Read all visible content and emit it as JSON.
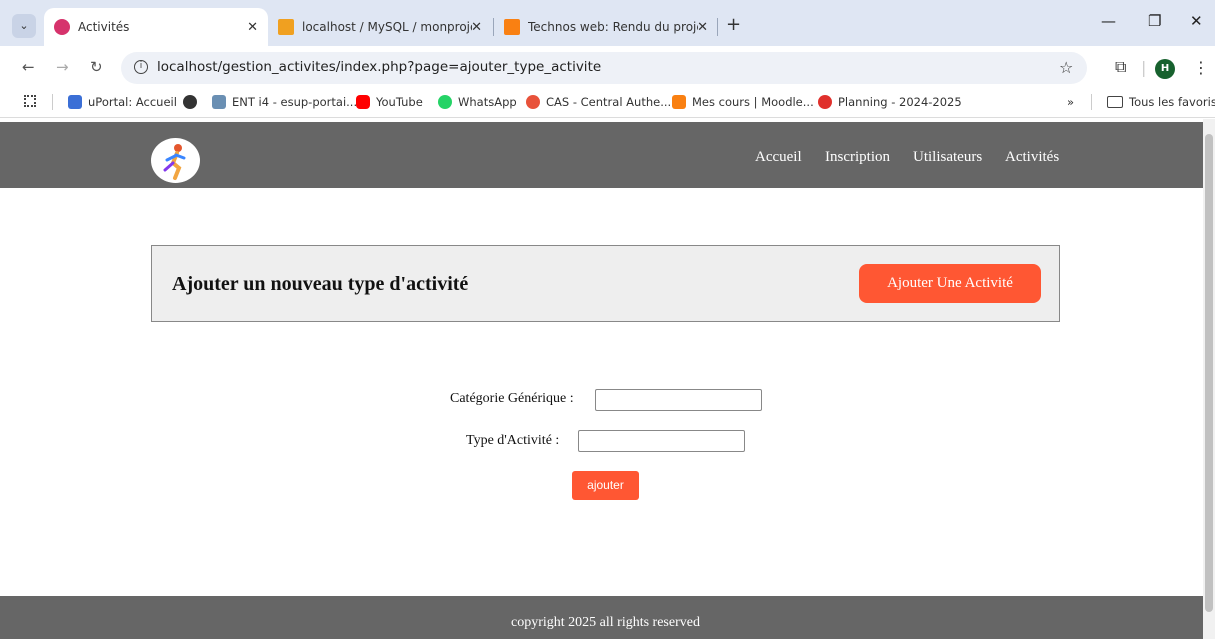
{
  "browser": {
    "tabs": [
      {
        "title": "Activités",
        "favicon_color": "#d6336c"
      },
      {
        "title": "localhost / MySQL / monprojet",
        "favicon_color": "#f0a020"
      },
      {
        "title": "Technos web: Rendu du projet",
        "favicon_color": "#f98012"
      }
    ],
    "url": "localhost/gestion_activites/index.php?page=ajouter_type_activite",
    "profile_initial": "H",
    "bookmarks": [
      {
        "label": "uPortal: Accueil",
        "color": "#3b6fd6"
      },
      {
        "label": "",
        "color": "#333333"
      },
      {
        "label": "ENT i4 - esup-portai...",
        "color": "#6a8fb3"
      },
      {
        "label": "YouTube",
        "color": "#ff0000"
      },
      {
        "label": "WhatsApp",
        "color": "#25d366"
      },
      {
        "label": "CAS - Central Authe...",
        "color": "#e8523a"
      },
      {
        "label": "Mes cours | Moodle...",
        "color": "#f98012"
      },
      {
        "label": "Planning - 2024-2025",
        "color": "#e0302c"
      }
    ],
    "all_bookmarks_label": "Tous les favoris"
  },
  "site": {
    "nav": [
      "Accueil",
      "Inscription",
      "Utilisateurs",
      "Activités"
    ],
    "banner_title": "Ajouter un nouveau type d'activité",
    "banner_button": "Ajouter Une Activité",
    "form": {
      "category_label": "Catégorie Générique :",
      "category_value": "",
      "type_label": "Type d'Activité :",
      "type_value": "",
      "submit_label": "ajouter"
    },
    "footer": "copyright 2025 all rights reserved"
  },
  "colors": {
    "accent": "#ff5733",
    "header_bg": "#666666",
    "banner_bg": "#eeeeee"
  }
}
